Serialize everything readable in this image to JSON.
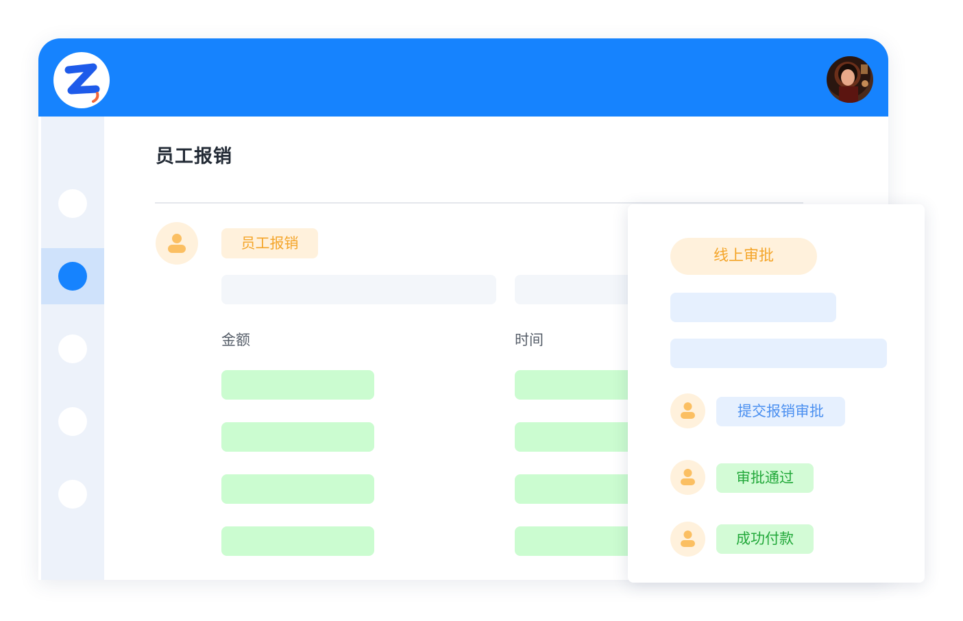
{
  "page": {
    "title": "员工报销"
  },
  "header": {
    "logo_icon": "z-logo-icon",
    "avatar_icon": "user-avatar"
  },
  "sidebar": {
    "items": [
      {
        "icon": "nav-dot-icon",
        "active": false
      },
      {
        "icon": "nav-dot-icon",
        "active": true
      },
      {
        "icon": "nav-dot-icon",
        "active": false
      },
      {
        "icon": "nav-dot-icon",
        "active": false
      },
      {
        "icon": "nav-dot-icon",
        "active": false
      }
    ]
  },
  "main": {
    "record_tag": "员工报销",
    "columns": {
      "amount_label": "金额",
      "time_label": "时间"
    }
  },
  "approval_card": {
    "title": "线上审批",
    "steps": [
      {
        "label": "提交报销审批",
        "style": "blue"
      },
      {
        "label": "审批通过",
        "style": "green"
      },
      {
        "label": "成功付款",
        "style": "green"
      }
    ]
  },
  "colors": {
    "brand_blue": "#1683fe",
    "accent_orange": "#f4a52a",
    "success_green": "#22a83a",
    "sidebar_bg": "#edf2fa"
  }
}
